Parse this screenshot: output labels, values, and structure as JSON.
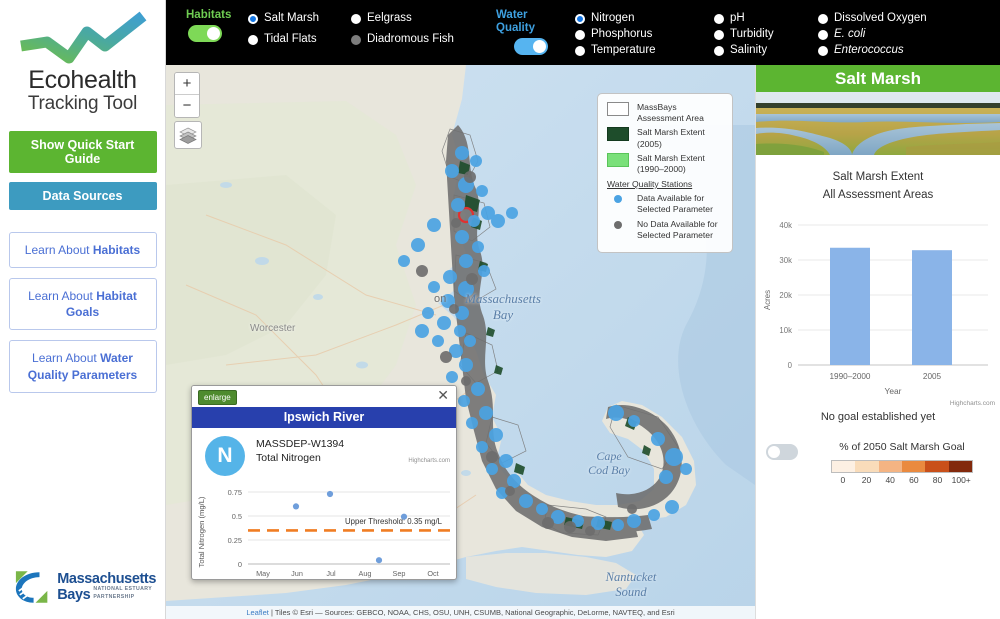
{
  "sidebar": {
    "logo_title": "Ecohealth",
    "logo_subtitle": "Tracking Tool",
    "quick_start_label": "Show Quick Start Guide",
    "data_sources_label": "Data Sources",
    "learn_buttons": [
      {
        "prefix": "Learn About ",
        "strong": "Habitats"
      },
      {
        "prefix": "Learn About ",
        "strong": "Habitat Goals"
      },
      {
        "prefix": "Learn About ",
        "strong": "Water Quality Parameters"
      }
    ],
    "partner_line1": "Massachusetts",
    "partner_line2": "Bays",
    "partner_line3a": "NATIONAL ESTUARY",
    "partner_line3b": "PARTNERSHIP"
  },
  "topbar": {
    "habitats_label": "Habitats",
    "habitats_toggle_on": true,
    "water_quality_label": "Water\nQuality",
    "water_quality_toggle_on": true,
    "habitat_options": [
      {
        "label": "Salt Marsh",
        "state": "selected"
      },
      {
        "label": "Tidal Flats",
        "state": "available"
      },
      {
        "label": "Eelgrass",
        "state": "available"
      },
      {
        "label": "Diadromous Fish",
        "state": "disabled"
      }
    ],
    "parameter_options": [
      {
        "label": "Nitrogen",
        "state": "selected",
        "italic": false
      },
      {
        "label": "Phosphorus",
        "state": "available",
        "italic": false
      },
      {
        "label": "Temperature",
        "state": "available",
        "italic": false
      },
      {
        "label": "pH",
        "state": "available",
        "italic": false
      },
      {
        "label": "Turbidity",
        "state": "available",
        "italic": false
      },
      {
        "label": "Salinity",
        "state": "available",
        "italic": false
      },
      {
        "label": "Dissolved Oxygen",
        "state": "available",
        "italic": false
      },
      {
        "label": "E. coli",
        "state": "available",
        "italic": true
      },
      {
        "label": "Enterococcus",
        "state": "available",
        "italic": true
      }
    ]
  },
  "map": {
    "zoom_in_label": "+",
    "zoom_out_label": "−",
    "labels": {
      "massachusetts_bay": "Massachusetts\nBay",
      "cape_cod_bay": "Cape\nCod Bay",
      "nantucket_sound": "Nantucket\nSound",
      "worcester": "Worcester",
      "boston": "on"
    },
    "legend": {
      "items": [
        {
          "swatch": "box",
          "text": "MassBays Assessment Area"
        },
        {
          "swatch": "dark",
          "text": "Salt Marsh Extent (2005)"
        },
        {
          "swatch": "light",
          "text": "Salt Marsh Extent (1990–2000)"
        }
      ],
      "stations_heading": "Water Quality Stations",
      "station_items": [
        {
          "dot": "blue",
          "text": "Data Available for Selected Parameter"
        },
        {
          "dot": "grey",
          "text": "No Data Available for Selected Parameter"
        }
      ]
    },
    "attribution_link": "Leaflet",
    "attribution_text": " | Tiles © Esri — Sources: GEBCO, NOAA, CHS, OSU, UNH, CSUMB, National Geographic, DeLorme, NAVTEQ, and Esri"
  },
  "popup": {
    "enlarge_label": "enlarge",
    "close_label": "✕",
    "title": "Ipswich River",
    "parameter_initial": "N",
    "station_id": "MASSDEP-W1394",
    "parameter_name": "Total Nitrogen",
    "highcharts_credit": "Highcharts.com",
    "chart_data": {
      "type": "scatter",
      "title": "",
      "xlabel": "",
      "ylabel": "Total Nitrogen (mg/L)",
      "ylim": [
        0,
        0.85
      ],
      "yticks": [
        0,
        0.25,
        0.5,
        0.75
      ],
      "ytick_labels": [
        "0",
        "0.25",
        "0.5",
        "0.75"
      ],
      "xtick_labels": [
        "May\n2005",
        "Jun\n2005",
        "Jul\n2005",
        "Aug\n2005",
        "Sep\n2005",
        "Oct\n2005"
      ],
      "points": [
        {
          "x": 1.45,
          "y": 0.6
        },
        {
          "x": 2.45,
          "y": 0.73
        },
        {
          "x": 3.9,
          "y": 0.04
        },
        {
          "x": 4.65,
          "y": 0.49
        }
      ],
      "threshold_value": 0.35,
      "threshold_label": "Upper Threshold: 0.35 mg/L",
      "point_color": "#6f9edb",
      "threshold_color": "#f07d23",
      "grid": true
    }
  },
  "right_panel": {
    "header_title": "Salt Marsh",
    "chart_title_line1": "Salt Marsh Extent",
    "chart_title_line2": "All Assessment Areas",
    "highcharts_credit": "Highcharts.com",
    "goal_status_text": "No goal established yet",
    "goal_toggle_on": false,
    "goal_scale_label": "% of 2050 Salt Marsh Goal",
    "goal_scale_ticks": [
      "0",
      "20",
      "40",
      "60",
      "80",
      "100+"
    ],
    "goal_scale_colors": [
      "#fdf0e3",
      "#f9dcba",
      "#f4b483",
      "#ea8a3f",
      "#c9501a",
      "#82290c"
    ],
    "chart_data": {
      "type": "bar",
      "title": "Salt Marsh Extent",
      "subtitle": "All Assessment Areas",
      "categories": [
        "1990–2000",
        "2005"
      ],
      "values": [
        33500,
        32800
      ],
      "xlabel": "Year",
      "ylabel": "Acres",
      "ylim": [
        0,
        40000
      ],
      "yticks": [
        0,
        10000,
        20000,
        30000,
        40000
      ],
      "ytick_labels": [
        "0",
        "10k",
        "20k",
        "30k",
        "40k"
      ],
      "bar_color": "#8ab4e8",
      "grid": true
    }
  },
  "colors": {
    "accent_green": "#5cb531",
    "accent_blue": "#3d9bc0",
    "panel_header_green": "#5cb531",
    "popup_header_blue": "#2840ad",
    "selected_radio": "#1477e6"
  }
}
